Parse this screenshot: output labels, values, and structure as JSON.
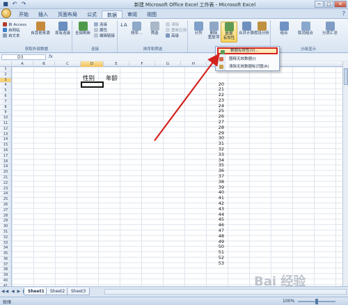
{
  "window": {
    "title": "新建 Microsoft Office Excel 工作表 - Microsoft Excel",
    "controls": [
      "─",
      "□",
      "✕"
    ]
  },
  "ribbon": {
    "tabs": [
      "开始",
      "插入",
      "页面布局",
      "公式",
      "数据",
      "审阅",
      "视图"
    ],
    "active_tab": "数据",
    "groups": {
      "external": {
        "label": "获取外部数据",
        "small": [
          "自 Access",
          "自网站",
          "自文本"
        ],
        "big": [
          "自其他来源",
          "现有连接"
        ]
      },
      "connections": {
        "label": "连接",
        "big": "全部刷新",
        "small": [
          "连接",
          "属性",
          "编辑链接"
        ]
      },
      "sort": {
        "label": "排序和筛选",
        "big": [
          "排序...",
          "筛选"
        ],
        "small": [
          "清除",
          "重新应用",
          "高级"
        ]
      },
      "tools": {
        "label": "数据工具",
        "big": [
          "分列",
          "删除\n重复项",
          "数据\n有效性",
          "合并计算",
          "假设分析"
        ]
      },
      "outline": {
        "label": "分级显示",
        "big": [
          "组合",
          "取消组合",
          "分类汇总"
        ]
      }
    }
  },
  "formula_bar": {
    "name_box": "D3",
    "fx": "fx"
  },
  "dropdown": {
    "items": [
      "数据有效性(V)...",
      "圈释无效数据(I)",
      "清除无效数据标识圈(R)"
    ],
    "highlighted_index": 0
  },
  "sheet": {
    "columns": [
      "A",
      "B",
      "C",
      "D",
      "E",
      "F",
      "G",
      "H",
      "I"
    ],
    "selected_column": "D",
    "rows": [
      "1",
      "2",
      "3",
      "4",
      "5",
      "6",
      "7",
      "8",
      "9",
      "10",
      "11",
      "12",
      "13",
      "14",
      "15",
      "16",
      "17",
      "18",
      "19",
      "20",
      "21",
      "22",
      "23",
      "24",
      "25",
      "26",
      "27",
      "28",
      "29",
      "30",
      "31",
      "32",
      "33",
      "34",
      "35",
      "36",
      "37",
      "38",
      "39",
      "40",
      "41"
    ],
    "selected_row": "3",
    "cells": {
      "D2": "性别",
      "E2": "年龄"
    },
    "i_column_values": [
      "20",
      "21",
      "22",
      "23",
      "24",
      "25",
      "26",
      "27",
      "28",
      "29",
      "30",
      "31",
      "32",
      "33",
      "34",
      "35",
      "36",
      "37",
      "38",
      "39",
      "40",
      "41",
      "42",
      "43",
      "44",
      "45",
      "46",
      "47",
      "48",
      "49",
      "50",
      "51",
      "52",
      "53"
    ]
  },
  "sheet_tabs": {
    "tabs": [
      "Sheet1",
      "Sheet2",
      "Sheet3"
    ],
    "active": "Sheet1",
    "nav": "◀◀ ◀ ▶ ▶▶"
  },
  "status": {
    "mode": "就绪",
    "zoom": "100%"
  },
  "watermark": "Bai 经验",
  "colors": {
    "ribbon_bg": "#dfe8f3",
    "highlight_border": "#d3231f",
    "arrow": "#d3231f"
  }
}
